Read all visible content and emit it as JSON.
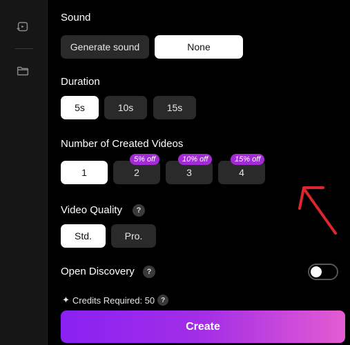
{
  "sidebar": {
    "icons": [
      "video-swap-icon",
      "folder-icon"
    ]
  },
  "sound": {
    "label": "Sound",
    "options": [
      "Generate sound",
      "None"
    ],
    "selected": "None"
  },
  "duration": {
    "label": "Duration",
    "options": [
      "5s",
      "10s",
      "15s"
    ],
    "selected": "5s"
  },
  "videos": {
    "label": "Number of Created Videos",
    "options": [
      "1",
      "2",
      "3",
      "4"
    ],
    "selected": "1",
    "badges": [
      "5% off",
      "10% off",
      "15% off"
    ]
  },
  "quality": {
    "label": "Video Quality",
    "options": [
      "Std.",
      "Pro."
    ],
    "selected": "Std.",
    "help": "?"
  },
  "discovery": {
    "label": "Open Discovery",
    "help": "?",
    "enabled": false
  },
  "credits": {
    "icon": "sparkle-icon",
    "text": "Credits Required: 50",
    "help": "?"
  },
  "create": {
    "label": "Create"
  },
  "colors": {
    "accent_start": "#8a21f2",
    "accent_end": "#e45cd2",
    "badge": "#a22bd6",
    "annotation_arrow": "#e0262d"
  }
}
